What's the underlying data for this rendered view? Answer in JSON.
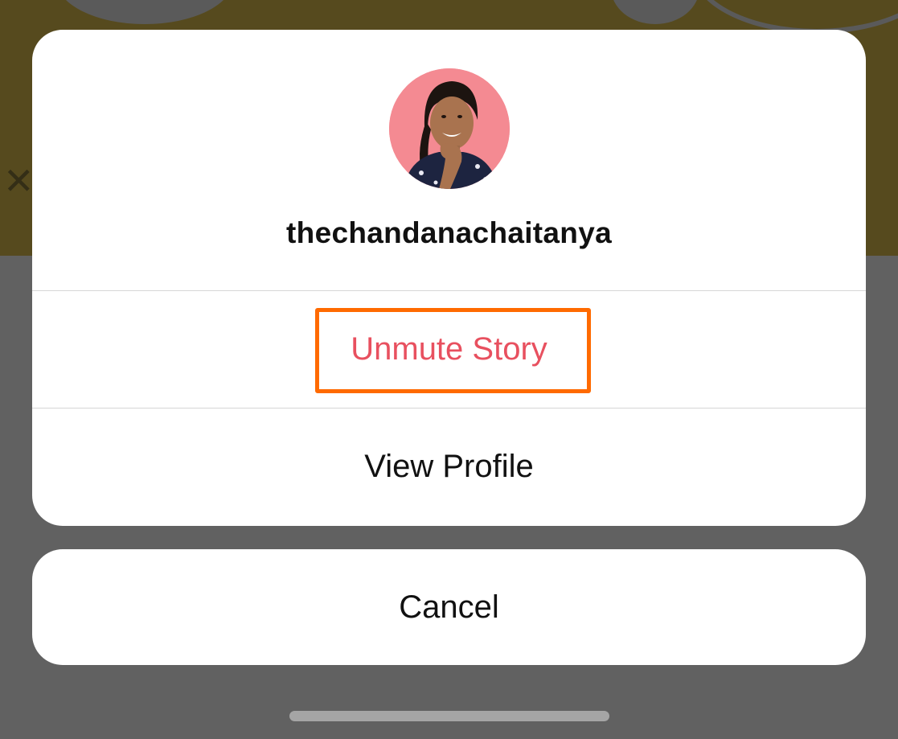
{
  "background": {
    "banner_color": "#e2c34f"
  },
  "sheet": {
    "avatar_icon": "profile-photo",
    "username": "thechandanachaitanya",
    "actions": [
      {
        "label": "Unmute Story",
        "color": "#e8505f",
        "highlighted": true
      },
      {
        "label": "View Profile",
        "color": "#111111"
      }
    ]
  },
  "cancel": {
    "label": "Cancel"
  },
  "colors": {
    "accent_destructive": "#e8505f",
    "highlight_box": "#ff6a00",
    "overlay": "rgba(0,0,0,0.62)"
  }
}
